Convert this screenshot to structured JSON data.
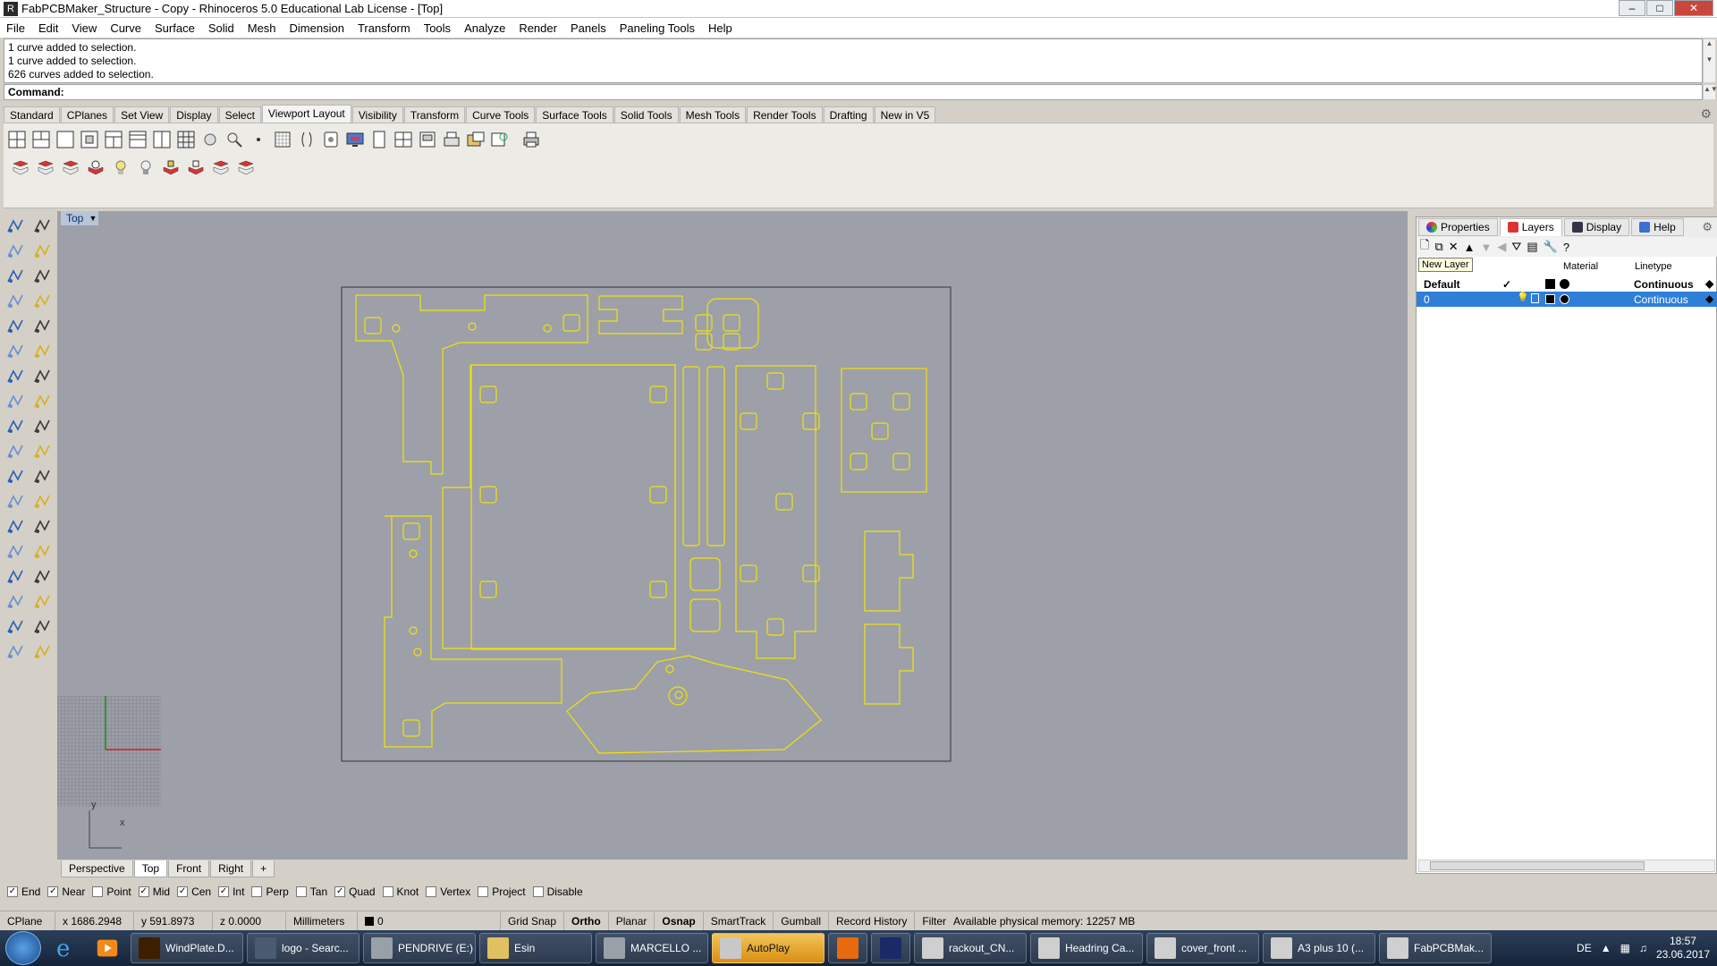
{
  "window": {
    "title": "FabPCBMaker_Structure - Copy - Rhinoceros 5.0 Educational Lab License - [Top]",
    "controls": [
      "–",
      "□",
      "✕"
    ]
  },
  "menu": [
    "File",
    "Edit",
    "View",
    "Curve",
    "Surface",
    "Solid",
    "Mesh",
    "Dimension",
    "Transform",
    "Tools",
    "Analyze",
    "Render",
    "Panels",
    "Paneling Tools",
    "Help"
  ],
  "command_history": [
    "1 curve added to selection.",
    "1 curve added to selection.",
    "626 curves added to selection."
  ],
  "command_prompt": "Command:",
  "toolbar_tabs": [
    "Standard",
    "CPlanes",
    "Set View",
    "Display",
    "Select",
    "Viewport Layout",
    "Visibility",
    "Transform",
    "Curve Tools",
    "Surface Tools",
    "Solid Tools",
    "Mesh Tools",
    "Render Tools",
    "Drafting",
    "New in V5"
  ],
  "active_toolbar_tab": "Viewport Layout",
  "viewport": {
    "title": "Top",
    "axis_y": "y",
    "axis_x": "x",
    "tabs": [
      "Perspective",
      "Top",
      "Front",
      "Right",
      "+"
    ],
    "active_tab": "Top",
    "background": "#9da0a8",
    "curve_color": "#f0e20c"
  },
  "panel": {
    "tabs": [
      "Properties",
      "Layers",
      "Display",
      "Help"
    ],
    "active_tab": "Layers",
    "tooltip": "New Layer",
    "columns": {
      "material": "Material",
      "linetype": "Linetype"
    },
    "layers": [
      {
        "name": "Default",
        "current": "✓",
        "linetype": "Continuous"
      },
      {
        "name": "0",
        "current": "",
        "linetype": "Continuous"
      }
    ],
    "selected_layer": "0"
  },
  "osnap": [
    {
      "label": "End",
      "checked": true
    },
    {
      "label": "Near",
      "checked": true
    },
    {
      "label": "Point",
      "checked": false
    },
    {
      "label": "Mid",
      "checked": true
    },
    {
      "label": "Cen",
      "checked": true
    },
    {
      "label": "Int",
      "checked": true
    },
    {
      "label": "Perp",
      "checked": false
    },
    {
      "label": "Tan",
      "checked": false
    },
    {
      "label": "Quad",
      "checked": true
    },
    {
      "label": "Knot",
      "checked": false
    },
    {
      "label": "Vertex",
      "checked": false
    },
    {
      "label": "Project",
      "checked": false
    },
    {
      "label": "Disable",
      "checked": false
    }
  ],
  "status": {
    "cplane": "CPlane",
    "x": "x 1686.2948",
    "y": "y 591.8973",
    "z": "z 0.0000",
    "units": "Millimeters",
    "layer": "0",
    "grid_snap": "Grid Snap",
    "ortho": "Ortho",
    "planar": "Planar",
    "osnap": "Osnap",
    "smarttrack": "SmartTrack",
    "gumball": "Gumball",
    "record_history": "Record History",
    "filter": "Filter",
    "memory": "Available physical memory: 12257 MB"
  },
  "taskbar": {
    "items": [
      {
        "label": "WindPlate.D...",
        "color": "#3d1f00"
      },
      {
        "label": "logo - Searc...",
        "color": "#4a5a70"
      },
      {
        "label": "PENDRIVE (E:)",
        "color": "#9aa0a8"
      },
      {
        "label": "Esin",
        "color": "#e0c060"
      },
      {
        "label": "MARCELLO ...",
        "color": "#9aa0a8"
      },
      {
        "label": "AutoPlay",
        "color": "#c8c8c8"
      },
      {
        "label": "",
        "color": "#e86a10"
      },
      {
        "label": "",
        "color": "#1b2a66"
      },
      {
        "label": "rackout_CN...",
        "color": "#cfcfcf"
      },
      {
        "label": "Headring Ca...",
        "color": "#cfcfcf"
      },
      {
        "label": "cover_front ...",
        "color": "#cfcfcf"
      },
      {
        "label": "A3 plus 10 (...",
        "color": "#cfcfcf"
      },
      {
        "label": "FabPCBMak...",
        "color": "#cfcfcf"
      }
    ],
    "active_item": "AutoPlay",
    "language": "DE",
    "time": "18:57",
    "date": "23.06.2017"
  }
}
